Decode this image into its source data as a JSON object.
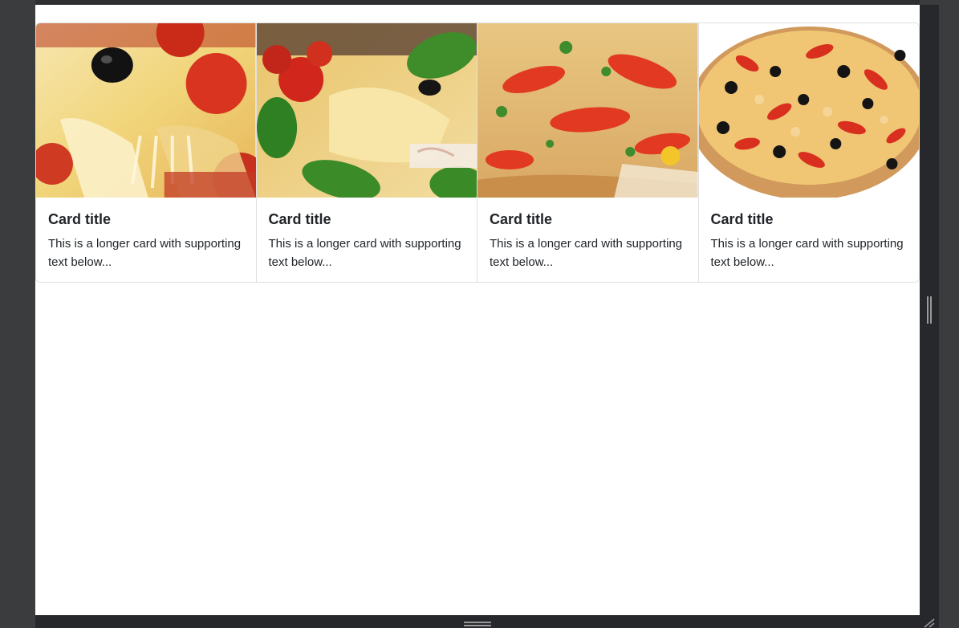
{
  "cards": [
    {
      "title": "Card title",
      "text": "This is a longer card with supporting text below...",
      "image_icon": "pizza-slice-cheese-pull-image"
    },
    {
      "title": "Card title",
      "text": "This is a longer card with supporting text below...",
      "image_icon": "pizza-slice-basil-image"
    },
    {
      "title": "Card title",
      "text": "This is a longer card with supporting text below...",
      "image_icon": "pizza-peppers-closeup-image"
    },
    {
      "title": "Card title",
      "text": "This is a longer card with supporting text below...",
      "image_icon": "whole-pizza-olives-image"
    }
  ],
  "colors": {
    "viewport_bg": "#ffffff",
    "frame_bg": "#3b3c3d",
    "handle_bg": "#27282b",
    "card_border": "#dfe0e2",
    "text": "#212529"
  }
}
